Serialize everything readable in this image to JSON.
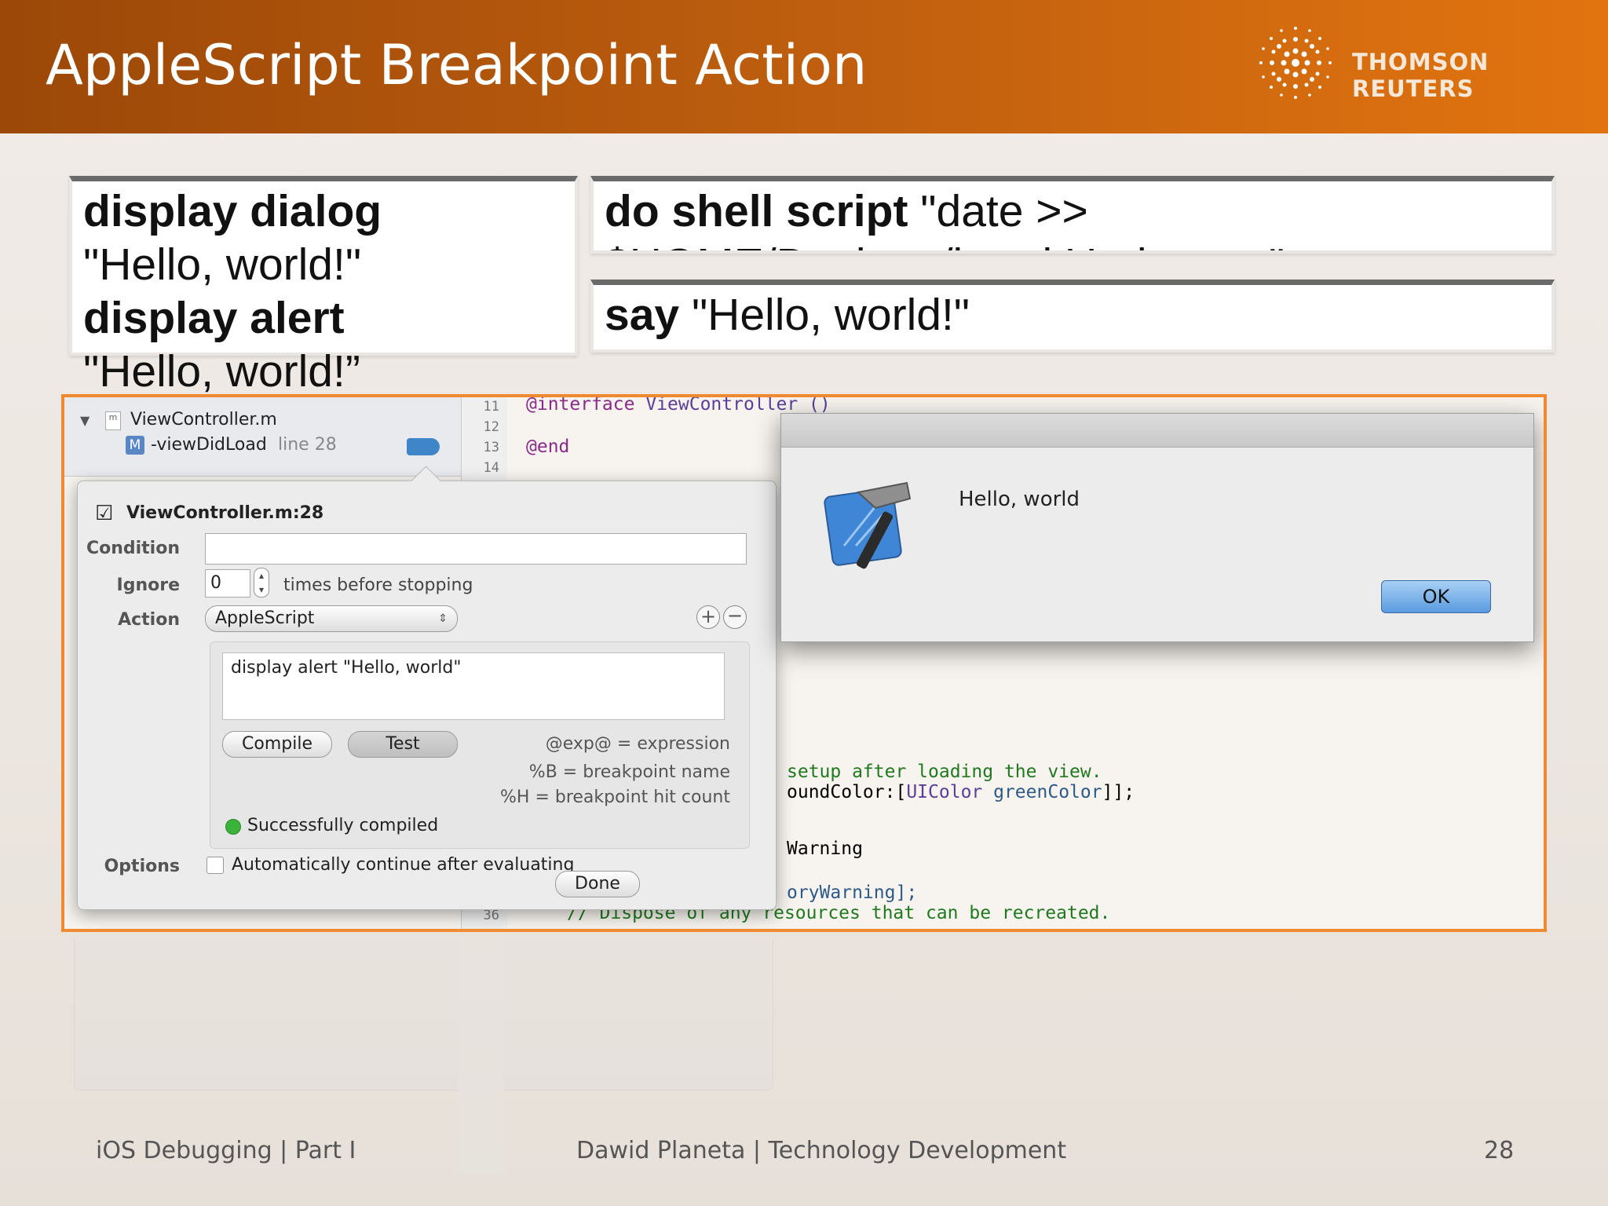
{
  "slide": {
    "title": "AppleScript Breakpoint Action",
    "brand": "THOMSON REUTERS",
    "footer_left": "iOS Debugging | Part I",
    "footer_center": "Dawid Planeta | Technology Development",
    "page_number": "28"
  },
  "boxes": {
    "dialog_cmd": "display dialog",
    "dialog_arg": "\"Hello, world!\"",
    "alert_cmd": "display alert",
    "alert_arg": "\"Hello, world!”",
    "shell_cmd": "do shell script",
    "shell_arg1": " \"date >>",
    "shell_arg2": "$HOME/Desktop/breakUpdate.txt\"",
    "say_cmd": "say",
    "say_arg": " \"Hello, world!\""
  },
  "navigator": {
    "file": "ViewController.m",
    "method": "-viewDidLoad",
    "line": "line 28"
  },
  "editor": {
    "line_numbers": [
      "11",
      "12",
      "13",
      "14",
      "36"
    ],
    "code_interface_kw": "@interface",
    "code_interface_cls": "ViewController ()",
    "code_end": "@end",
    "code_setup": "setup after loading the view.",
    "code_color_a": "oundColor:[",
    "code_color_b": "UIColor",
    "code_color_c": " greenColor",
    "code_color_d": "]];",
    "code_warning": "Warning",
    "code_memory": "oryWarning];",
    "code_dispose": "// Dispose of any resources that can be recreated."
  },
  "breakpoint": {
    "name": "ViewController.m:28",
    "condition_label": "Condition",
    "condition_value": "",
    "ignore_label": "Ignore",
    "ignore_value": "0",
    "ignore_suffix": "times before stopping",
    "action_label": "Action",
    "action_value": "AppleScript",
    "script": "display alert \"Hello, world\"",
    "compile_label": "Compile",
    "test_label": "Test",
    "hint1": "@exp@ = expression",
    "hint2": "%B = breakpoint name",
    "hint3": "%H = breakpoint hit count",
    "status": "Successfully compiled",
    "options_label": "Options",
    "options_text": "Automatically continue after evaluating",
    "done_label": "Done"
  },
  "alert": {
    "message": "Hello, world",
    "ok_label": "OK"
  },
  "colors": {
    "accent": "#f08a32",
    "header": "#c1600f",
    "status_green": "#3bb33b",
    "breakpoint_blue": "#3f86c9"
  }
}
